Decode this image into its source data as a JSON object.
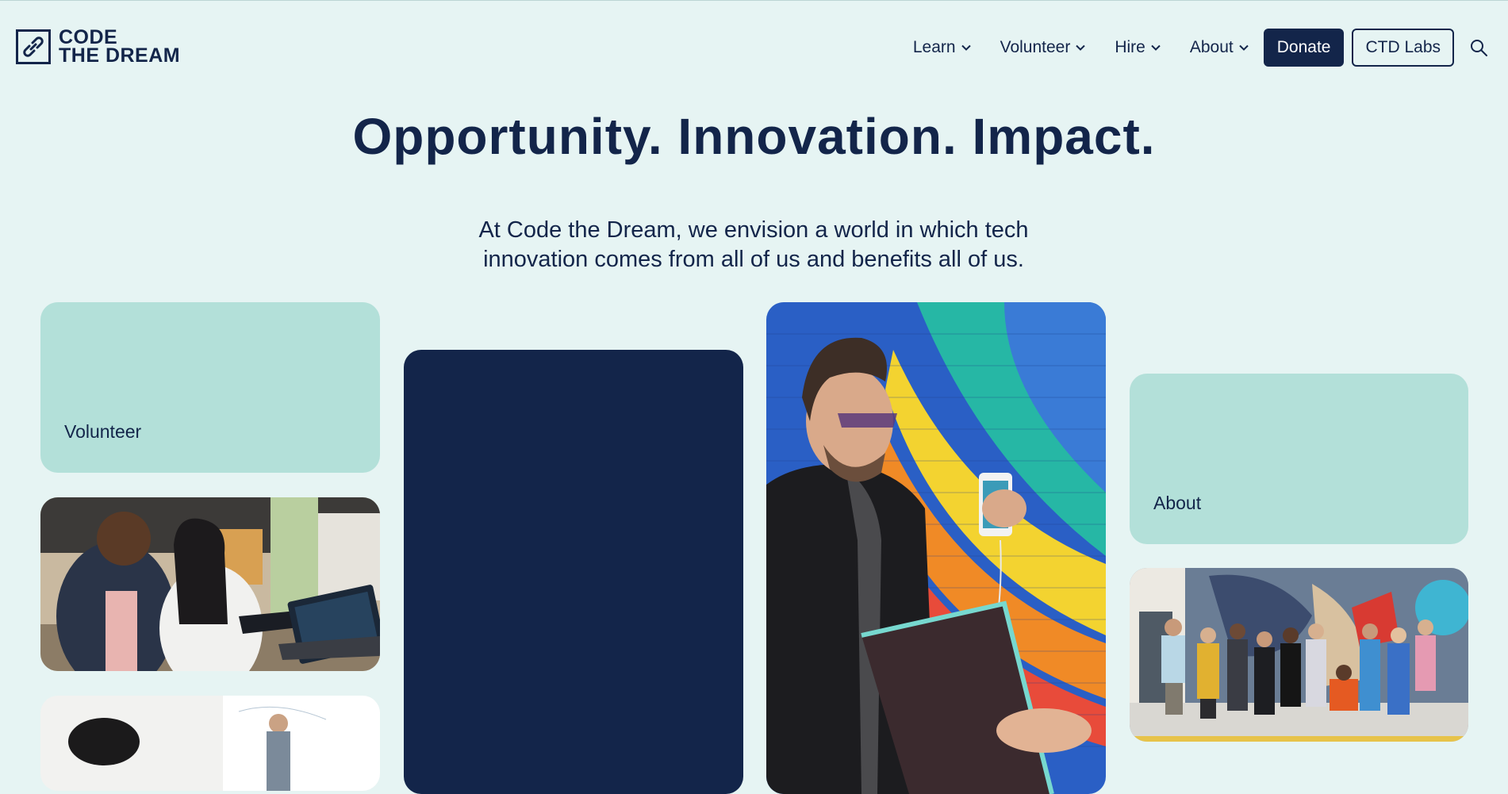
{
  "brand": {
    "line1": "CODE",
    "line2": "THE DREAM",
    "icon": "link-chain-icon"
  },
  "nav": {
    "items": [
      {
        "label": "Learn",
        "icon": "chevron-down-icon"
      },
      {
        "label": "Volunteer",
        "icon": "chevron-down-icon"
      },
      {
        "label": "Hire",
        "icon": "chevron-down-icon"
      },
      {
        "label": "About",
        "icon": "chevron-down-icon"
      }
    ],
    "donate_label": "Donate",
    "labs_label": "CTD Labs",
    "search_icon": "search-icon"
  },
  "hero": {
    "title": "Opportunity. Innovation. Impact.",
    "subtitle_line1": "At Code the Dream, we envision a world in which tech",
    "subtitle_line2": "innovation comes from all of us and benefits all of us."
  },
  "cards": {
    "volunteer_label": "Volunteer",
    "about_label": "About"
  },
  "colors": {
    "background": "#e6f4f3",
    "navy": "#13254a",
    "mint": "#b3e0d9"
  }
}
